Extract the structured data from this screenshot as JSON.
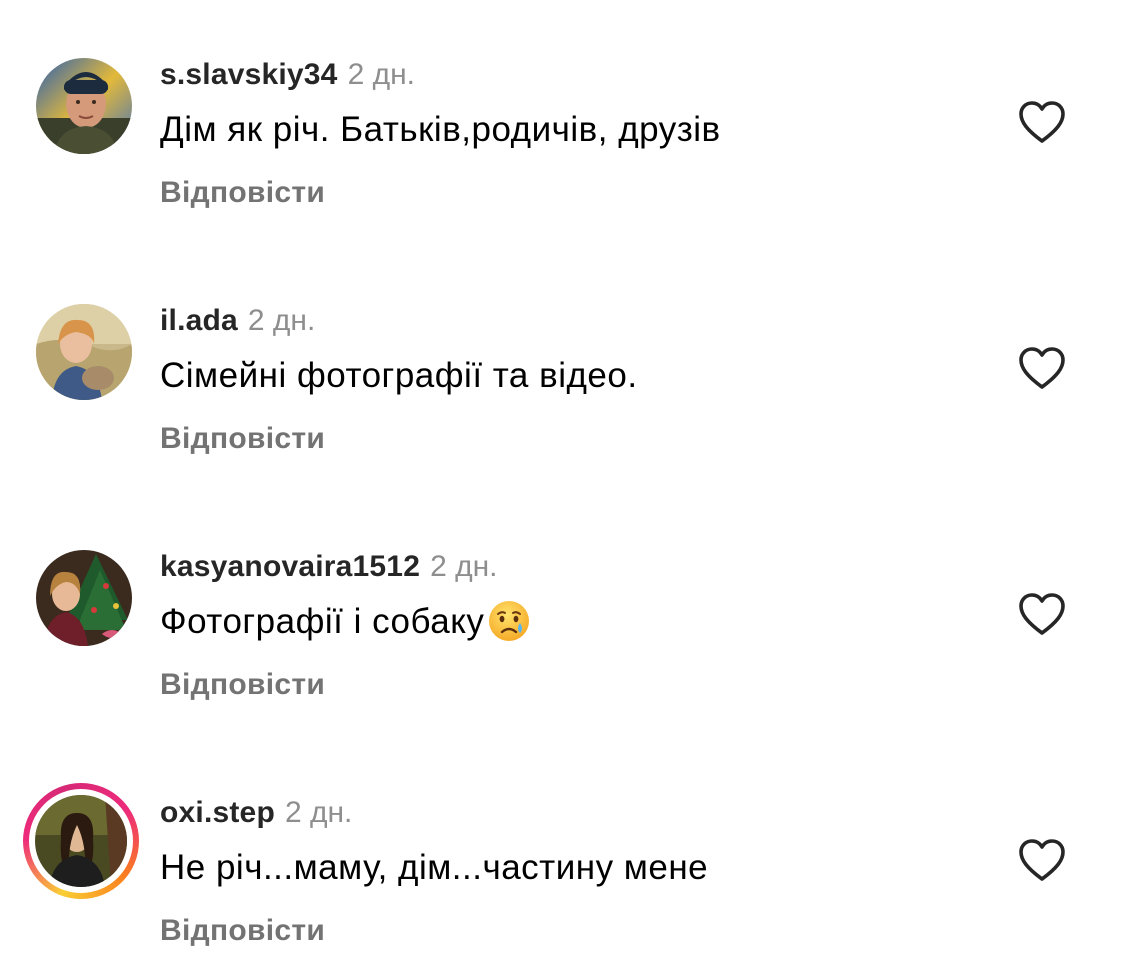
{
  "comments": [
    {
      "username": "s.slavskiy34",
      "time": "2 дн.",
      "text": "Дім як річ. Батьків,родичів, друзів",
      "emoji_name": "",
      "reply_label": "Відповісти"
    },
    {
      "username": "il.ada",
      "time": "2 дн.",
      "text": "Сімейні фотографії та відео.",
      "emoji_name": "",
      "reply_label": "Відповісти"
    },
    {
      "username": "kasyanovaira1512",
      "time": "2 дн.",
      "text": "Фотографії і собаку",
      "emoji_name": "crying-face",
      "reply_label": "Відповісти"
    },
    {
      "username": "oxi.step",
      "time": "2 дн.",
      "text": "Не річ...маму, дім...частину мене",
      "emoji_name": "",
      "reply_label": "Відповісти"
    }
  ],
  "icons": {
    "like": "heart-outline-icon",
    "emoji": "crying-face-emoji"
  },
  "colors": {
    "username": "#262626",
    "meta": "#8e8e8e",
    "reply": "#737373",
    "story_ring_start": "#f9ce34",
    "story_ring_mid": "#ee2a7b",
    "story_ring_end": "#fa7e1e"
  }
}
